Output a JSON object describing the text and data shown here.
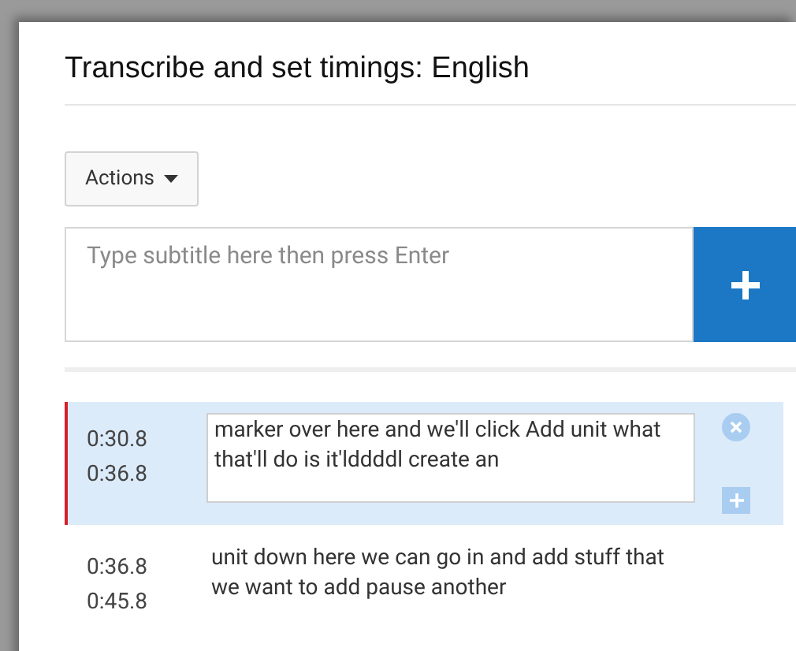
{
  "title": "Transcribe and set timings: English",
  "actions_button": {
    "label": "Actions"
  },
  "subtitle_input": {
    "placeholder": "Type subtitle here then press Enter"
  },
  "rows": [
    {
      "start": "0:30.8",
      "end": "0:36.8",
      "text": "marker over here and we'll click Add unit what that'll do is it'lddddl create an",
      "selected": true
    },
    {
      "start": "0:36.8",
      "end": "0:45.8",
      "text": "unit down here we can go in and add stuff that we want to add pause another",
      "selected": false
    }
  ]
}
